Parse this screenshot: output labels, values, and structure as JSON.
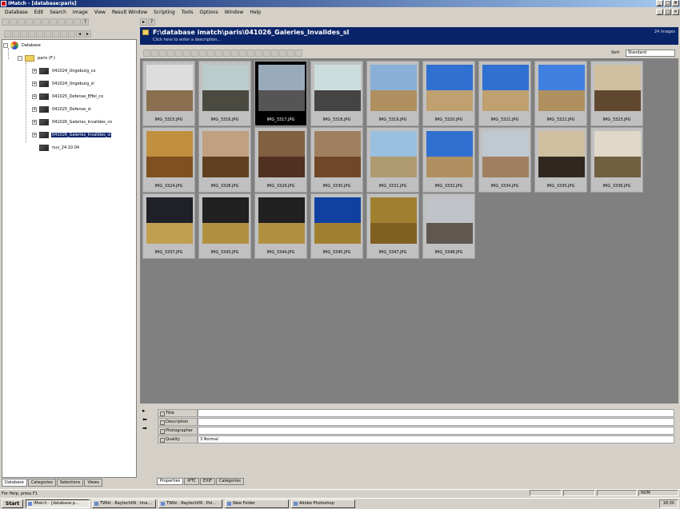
{
  "window": {
    "title": "IMatch - [database:paris]",
    "icon_name": "app-icon"
  },
  "menu": [
    "Database",
    "Edit",
    "Search",
    "Image",
    "View",
    "Result Window",
    "Scripting",
    "Tools",
    "Options",
    "Window",
    "Help"
  ],
  "tree": {
    "root": "Database",
    "folder": "paris (F:)",
    "items": [
      {
        "label": "041024_Ungeburg_co",
        "expandable": true
      },
      {
        "label": "041024_Ungeburg_sl",
        "expandable": true
      },
      {
        "label": "041025_Defense_Effel_co",
        "expandable": true
      },
      {
        "label": "041025_Defense_sl",
        "expandable": true
      },
      {
        "label": "041026_Galeries_Invalides_co",
        "expandable": true
      },
      {
        "label": "041026_Galeries_Invalides_sl",
        "expandable": true,
        "selected": true
      },
      {
        "label": "nuv_24.10.04",
        "expandable": false
      }
    ]
  },
  "left_tabs": [
    "Database",
    "Categories",
    "Selections",
    "Views"
  ],
  "header": {
    "path": "F:\\database imatch\\paris\\041026_Galeries_Invalides_sl",
    "description": "Click here to enter a description...",
    "count": "24 images"
  },
  "sort": {
    "label": "Sort",
    "value": "Standard"
  },
  "thumbnails": [
    {
      "name": "IMG_3315.JPG",
      "sky": "#ddd",
      "ground": "#8a7050"
    },
    {
      "name": "IMG_3316.JPG",
      "sky": "#bcc",
      "ground": "#4a4a40"
    },
    {
      "name": "IMG_3317.JPG",
      "sky": "#9ab",
      "ground": "#555",
      "selected": true
    },
    {
      "name": "IMG_3318.JPG",
      "sky": "#cdd",
      "ground": "#444"
    },
    {
      "name": "IMG_3319.JPG",
      "sky": "#8ab0d8",
      "ground": "#b09060"
    },
    {
      "name": "IMG_3320.JPG",
      "sky": "#3070d0",
      "ground": "#c0a070"
    },
    {
      "name": "IMG_3321.JPG",
      "sky": "#3070d0",
      "ground": "#c0a070"
    },
    {
      "name": "IMG_3322.JPG",
      "sky": "#4080e0",
      "ground": "#b09060"
    },
    {
      "name": "IMG_3323.JPG",
      "sky": "#d0c0a0",
      "ground": "#604830"
    },
    {
      "name": "IMG_3324.JPG",
      "sky": "#c09040",
      "ground": "#805020"
    },
    {
      "name": "IMG_3328.JPG",
      "sky": "#c0a080",
      "ground": "#604020"
    },
    {
      "name": "IMG_3329.JPG",
      "sky": "#806040",
      "ground": "#503020"
    },
    {
      "name": "IMG_3330.JPG",
      "sky": "#a08060",
      "ground": "#704828"
    },
    {
      "name": "IMG_3331.JPG",
      "sky": "#9ac0e0",
      "ground": "#b09a70"
    },
    {
      "name": "IMG_3332.JPG",
      "sky": "#3070d0",
      "ground": "#b09060"
    },
    {
      "name": "IMG_3334.JPG",
      "sky": "#c0c8d0",
      "ground": "#a08060"
    },
    {
      "name": "IMG_3335.JPG",
      "sky": "#d0c0a0",
      "ground": "#302820"
    },
    {
      "name": "IMG_3336.JPG",
      "sky": "#e0d8c8",
      "ground": "#706040"
    },
    {
      "name": "IMG_3337.JPG",
      "sky": "#202028",
      "ground": "#c0a050"
    },
    {
      "name": "IMG_3343.JPG",
      "sky": "#202020",
      "ground": "#b09040"
    },
    {
      "name": "IMG_3344.JPG",
      "sky": "#202020",
      "ground": "#b09040"
    },
    {
      "name": "IMG_3345.JPG",
      "sky": "#1040a0",
      "ground": "#a08030"
    },
    {
      "name": "IMG_3347.JPG",
      "sky": "#a08030",
      "ground": "#806020"
    },
    {
      "name": "IMG_3348.JPG",
      "sky": "#c0c4c8",
      "ground": "#605850"
    }
  ],
  "properties": [
    {
      "key": "Title",
      "value": ""
    },
    {
      "key": "Description",
      "value": ""
    },
    {
      "key": "Photographer",
      "value": ""
    },
    {
      "key": "Quality",
      "value": "3 Normal"
    }
  ],
  "prop_tabs": [
    "Properties",
    "IPTC",
    "EXIF",
    "Categories"
  ],
  "status": {
    "help": "For Help, press F1",
    "mode": "NUM"
  },
  "taskbar": {
    "start": "Start",
    "tasks": [
      "IMatch - [database:p...",
      "TWiki . Raytech09 . Ima...",
      "TWiki . Raytech09 . Pol...",
      "New Folder",
      "Adobe Photoshop"
    ],
    "time": "18:30"
  }
}
